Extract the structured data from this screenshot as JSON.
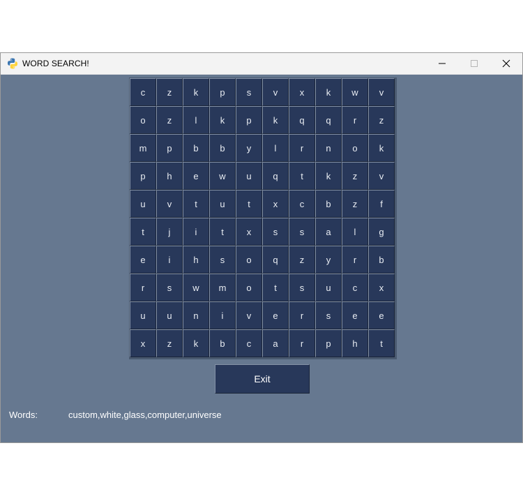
{
  "window": {
    "title": "WORD SEARCH!",
    "icon": "python-icon",
    "controls": [
      "minimize-icon",
      "maximize-icon",
      "close-icon"
    ]
  },
  "grid": {
    "rows": [
      [
        "c",
        "z",
        "k",
        "p",
        "s",
        "v",
        "x",
        "k",
        "w",
        "v"
      ],
      [
        "o",
        "z",
        "l",
        "k",
        "p",
        "k",
        "q",
        "q",
        "r",
        "z"
      ],
      [
        "m",
        "p",
        "b",
        "b",
        "y",
        "l",
        "r",
        "n",
        "o",
        "k"
      ],
      [
        "p",
        "h",
        "e",
        "w",
        "u",
        "q",
        "t",
        "k",
        "z",
        "v"
      ],
      [
        "u",
        "v",
        "t",
        "u",
        "t",
        "x",
        "c",
        "b",
        "z",
        "f"
      ],
      [
        "t",
        "j",
        "i",
        "t",
        "x",
        "s",
        "s",
        "a",
        "l",
        "g"
      ],
      [
        "e",
        "i",
        "h",
        "s",
        "o",
        "q",
        "z",
        "y",
        "r",
        "b"
      ],
      [
        "r",
        "s",
        "w",
        "m",
        "o",
        "t",
        "s",
        "u",
        "c",
        "x"
      ],
      [
        "u",
        "u",
        "n",
        "i",
        "v",
        "e",
        "r",
        "s",
        "e",
        "e"
      ],
      [
        "x",
        "z",
        "k",
        "b",
        "c",
        "a",
        "r",
        "p",
        "h",
        "t"
      ]
    ]
  },
  "exit_button": {
    "label": "Exit"
  },
  "words": {
    "label": "Words:",
    "list": "custom,white,glass,computer,universe"
  },
  "colors": {
    "window_bg": "#667890",
    "cell_bg": "#28385a",
    "cell_text": "#e8ecf2"
  }
}
